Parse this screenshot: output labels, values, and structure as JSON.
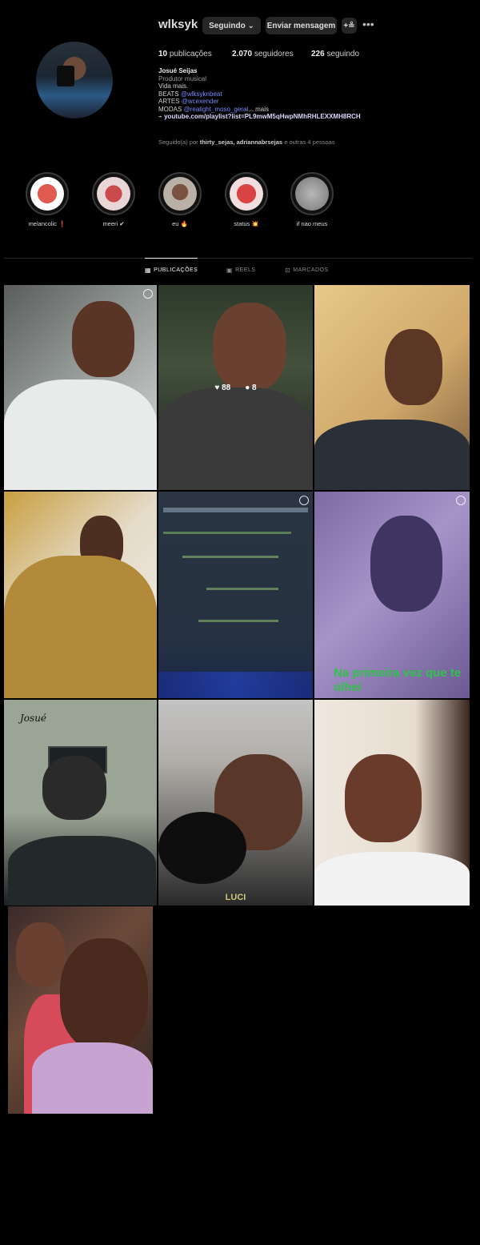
{
  "header": {
    "username": "wlksyk",
    "follow_button": "Seguindo ⌄",
    "message_button": "Enviar mensagem",
    "suggest_button": "+≗",
    "more_icon": "more-horizontal-icon"
  },
  "stats": {
    "posts_count": "10",
    "posts_label": "publicações",
    "followers_count": "2.070",
    "followers_label": "seguidores",
    "following_count": "226",
    "following_label": "seguindo"
  },
  "bio": {
    "name": "Josué Seijas",
    "category": "Produtor musical",
    "line1": "Vida mais.",
    "line2_prefix": "BEATS",
    "line2_link": "@wlksyknbeat",
    "line3_prefix": "ARTES",
    "line3_link": "@wcexender",
    "line4_prefix": "MODAS",
    "line4_link": "@realight_moso_geral",
    "line4_suffix": "... mais",
    "url": "youtube.com/playlist?list=PL9mwM5qHwpNMhRHLEXXMH8RCH"
  },
  "followed_by": {
    "prefix": "Seguido(a) por",
    "names": "thirty_sejas, adriannabrsejas",
    "suffix": "e outras 4 pessoas"
  },
  "highlights": [
    {
      "label": "melancolic ❗",
      "color": "#b8322f"
    },
    {
      "label": "meeri ✔",
      "color": "#a04442"
    },
    {
      "label": "eu 🔥",
      "color": "#6b4a38"
    },
    {
      "label": "status 💥",
      "color": "#c63b3b"
    },
    {
      "label": "if nao meus",
      "color": "#8a8a8a"
    }
  ],
  "tabs": [
    {
      "label": "PUBLICAÇÕES",
      "icon": "grid-icon",
      "active": true
    },
    {
      "label": "REELS",
      "icon": "reels-icon",
      "active": false
    },
    {
      "label": "MARCADOS",
      "icon": "tagged-icon",
      "active": false
    }
  ],
  "posts": [
    {
      "kind": "photo"
    },
    {
      "kind": "photo",
      "overlay_likes": "88",
      "overlay_comments": "8"
    },
    {
      "kind": "photo"
    },
    {
      "kind": "photo"
    },
    {
      "kind": "screenshot"
    },
    {
      "kind": "photo",
      "caption": "Na primeira vez que te olhei"
    },
    {
      "kind": "illustration",
      "caption": "Josué"
    },
    {
      "kind": "photo",
      "caption": "LUCI"
    },
    {
      "kind": "photo"
    },
    {
      "kind": "photo"
    }
  ]
}
